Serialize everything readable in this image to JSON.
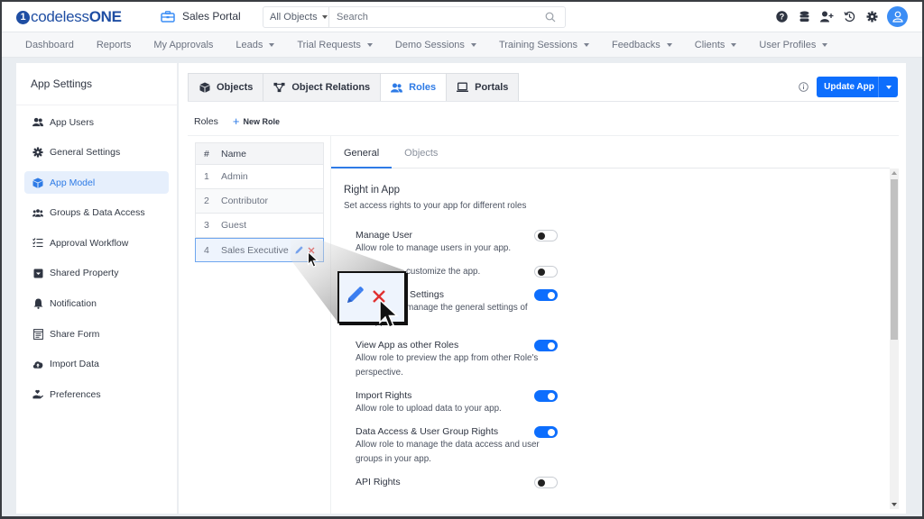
{
  "brand": {
    "name_light": "codeless",
    "name_bold": "ONE",
    "mark": "1"
  },
  "portal": {
    "name": "Sales Portal",
    "icon": "toolbox-icon"
  },
  "search": {
    "scope": "All Objects",
    "placeholder": "Search",
    "value": ""
  },
  "top_icons": [
    "help-icon",
    "database-icon",
    "add-user-icon",
    "history-icon",
    "settings-icon",
    "user-avatar-icon"
  ],
  "nav": [
    {
      "label": "Dashboard",
      "dropdown": false
    },
    {
      "label": "Reports",
      "dropdown": false
    },
    {
      "label": "My Approvals",
      "dropdown": false
    },
    {
      "label": "Leads",
      "dropdown": true
    },
    {
      "label": "Trial Requests",
      "dropdown": true
    },
    {
      "label": "Demo Sessions",
      "dropdown": true
    },
    {
      "label": "Training Sessions",
      "dropdown": true
    },
    {
      "label": "Feedbacks",
      "dropdown": true
    },
    {
      "label": "Clients",
      "dropdown": true
    },
    {
      "label": "User Profiles",
      "dropdown": true
    }
  ],
  "sidebar": {
    "title": "App Settings",
    "items": [
      {
        "label": "App Users",
        "icon": "users-icon",
        "active": false
      },
      {
        "label": "General Settings",
        "icon": "gear-icon",
        "active": false
      },
      {
        "label": "App Model",
        "icon": "cube-icon",
        "active": true
      },
      {
        "label": "Groups & Data Access",
        "icon": "groups-icon",
        "active": false
      },
      {
        "label": "Approval Workflow",
        "icon": "checklist-icon",
        "active": false
      },
      {
        "label": "Shared Property",
        "icon": "inbox-icon",
        "active": false
      },
      {
        "label": "Notification",
        "icon": "bell-icon",
        "active": false
      },
      {
        "label": "Share Form",
        "icon": "form-icon",
        "active": false
      },
      {
        "label": "Import Data",
        "icon": "cloud-upload-icon",
        "active": false
      },
      {
        "label": "Preferences",
        "icon": "hand-heart-icon",
        "active": false
      }
    ]
  },
  "tabs": [
    {
      "label": "Objects",
      "icon": "cube-icon",
      "active": false
    },
    {
      "label": "Object Relations",
      "icon": "relations-icon",
      "active": false
    },
    {
      "label": "Roles",
      "icon": "users-icon",
      "active": true
    },
    {
      "label": "Portals",
      "icon": "laptop-icon",
      "active": false
    }
  ],
  "update_button": {
    "label": "Update App"
  },
  "roles_bar": {
    "label": "Roles",
    "new_role": "New Role"
  },
  "roles_table": {
    "headers": [
      "#",
      "Name"
    ],
    "rows": [
      {
        "num": "1",
        "name": "Admin",
        "selected": false
      },
      {
        "num": "2",
        "name": "Contributor",
        "selected": false
      },
      {
        "num": "3",
        "name": "Guest",
        "selected": false
      },
      {
        "num": "4",
        "name": "Sales Executive",
        "selected": true
      }
    ]
  },
  "subtabs": [
    {
      "label": "General",
      "active": true
    },
    {
      "label": "Objects",
      "active": false
    }
  ],
  "rights": {
    "title": "Right in App",
    "description": "Set access rights to your app for different roles",
    "permissions": [
      {
        "title": "Manage User",
        "description": "Allow role to manage users in your app.",
        "enabled": false
      },
      {
        "title": "",
        "description": "customize the app.",
        "enabled": false
      },
      {
        "title": "Settings",
        "description": "Allow role to manage the general settings of the app.",
        "enabled": true
      },
      {
        "title": "View App as other Roles",
        "description": "Allow role to preview the app from other Role's perspective.",
        "enabled": true
      },
      {
        "title": "Import Rights",
        "description": "Allow role to upload data to your app.",
        "enabled": true
      },
      {
        "title": "Data Access & User Group Rights",
        "description": "Allow role to manage the data access and user groups in your app.",
        "enabled": true
      },
      {
        "title": "API Rights",
        "description": "",
        "enabled": false
      }
    ]
  },
  "colors": {
    "accent": "#0d6efd",
    "brand": "#1f4ea3",
    "delete": "#e03131",
    "active_text": "#2e7be6"
  }
}
